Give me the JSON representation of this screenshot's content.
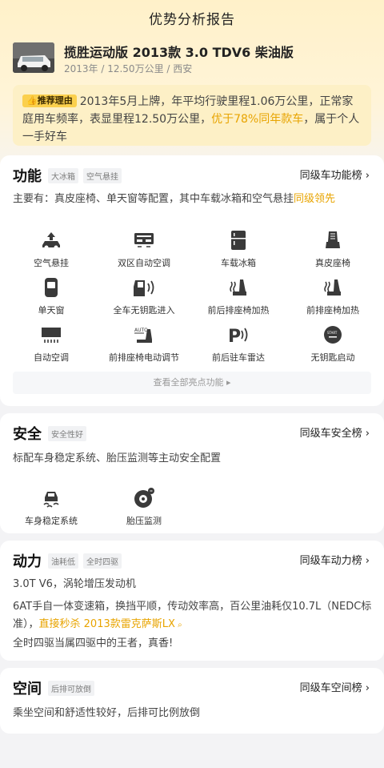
{
  "header": {
    "title": "优势分析报告"
  },
  "car": {
    "name": "揽胜运动版 2013款 3.0 TDV6 柴油版",
    "meta": "2013年 / 12.50万公里 / 西安"
  },
  "reason": {
    "badge": "推荐理由",
    "text_a": "2013年5月上牌，年平均行驶里程1.06万公里，正常家庭用车频率，表显里程12.50万公里，",
    "highlight": "优于78%同年款车",
    "text_b": "，属于个人一手好车"
  },
  "features_section": {
    "title": "功能",
    "tags": [
      "大冰箱",
      "空气悬挂"
    ],
    "rank_link": "同级车功能榜 ›",
    "desc_a": "主要有：真皮座椅、单天窗等配置，其中车载冰箱和空气悬挂",
    "desc_highlight": "同级领先",
    "items": [
      {
        "label": "空气悬挂",
        "icon": "air-suspension-icon"
      },
      {
        "label": "双区自动空调",
        "icon": "dual-zone-ac-icon"
      },
      {
        "label": "车载冰箱",
        "icon": "car-fridge-icon"
      },
      {
        "label": "真皮座椅",
        "icon": "leather-seat-icon"
      },
      {
        "label": "单天窗",
        "icon": "sunroof-icon"
      },
      {
        "label": "全车无钥匙进入",
        "icon": "keyless-entry-icon"
      },
      {
        "label": "前后排座椅加热",
        "icon": "seat-heating-icon"
      },
      {
        "label": "前排座椅加热",
        "icon": "front-seat-heating-icon"
      },
      {
        "label": "自动空调",
        "icon": "auto-ac-icon"
      },
      {
        "label": "前排座椅电动调节",
        "icon": "power-seat-icon"
      },
      {
        "label": "前后驻车雷达",
        "icon": "parking-radar-icon"
      },
      {
        "label": "无钥匙启动",
        "icon": "keyless-start-icon"
      }
    ],
    "see_all": "查看全部亮点功能 ▸"
  },
  "safety_section": {
    "title": "安全",
    "tags": [
      "安全性好"
    ],
    "rank_link": "同级车安全榜 ›",
    "desc": "标配车身稳定系统、胎压监测等主动安全配置",
    "items": [
      {
        "label": "车身稳定系统",
        "icon": "stability-control-icon"
      },
      {
        "label": "胎压监测",
        "icon": "tire-pressure-icon"
      }
    ]
  },
  "power_section": {
    "title": "动力",
    "tags": [
      "油耗低",
      "全时四驱"
    ],
    "rank_link": "同级车动力榜 ›",
    "line1": "3.0T V6，涡轮增压发动机",
    "line2_a": "6AT手自一体变速箱，换挡平顺，传动效率高，百公里油耗仅10.7L（NEDC标准），",
    "line2_highlight": "直接秒杀 2013款雷克萨斯LX",
    "line3": "全时四驱当属四驱中的王者，真香!"
  },
  "space_section": {
    "title": "空间",
    "tags": [
      "后排可放倒"
    ],
    "rank_link": "同级车空间榜 ›",
    "desc": "乘坐空间和舒适性较好，后排可比例放倒"
  },
  "colors": {
    "accent": "#e8a400",
    "badge": "#fbd04d",
    "icon": "#3a3a3a"
  }
}
